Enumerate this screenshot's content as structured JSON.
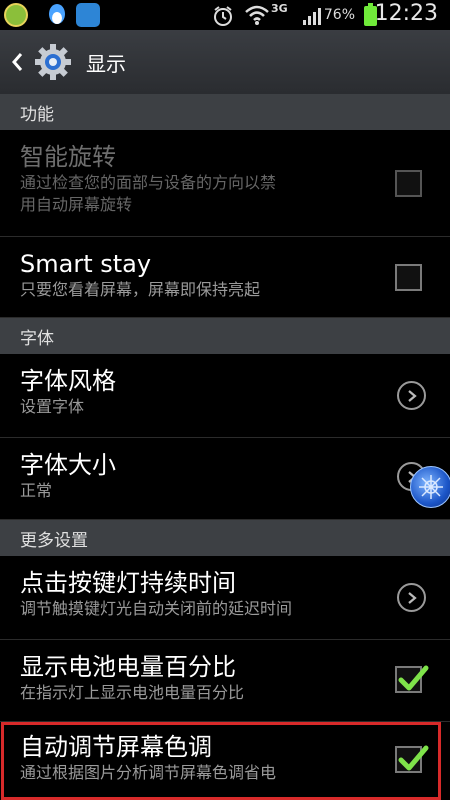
{
  "status_bar": {
    "network": "3G",
    "battery": "76%",
    "time": "12:23",
    "icons": [
      "app-icon",
      "qq-icon",
      "app-icon",
      "alarm-icon",
      "wifi-icon",
      "signal-icon",
      "battery-icon"
    ]
  },
  "header": {
    "title": "显示"
  },
  "sections": {
    "function": "功能",
    "font": "字体",
    "more": "更多设置"
  },
  "rows": {
    "smart_rotation": {
      "title": "智能旋转",
      "subtitle1": "通过检查您的面部与设备的方向以禁",
      "subtitle2": "用自动屏幕旋转"
    },
    "smart_stay": {
      "title": "Smart stay",
      "subtitle": "只要您看着屏幕，屏幕即保持亮起"
    },
    "font_style": {
      "title": "字体风格",
      "subtitle": "设置字体"
    },
    "font_size": {
      "title": "字体大小",
      "subtitle": "正常"
    },
    "key_light": {
      "title": "点击按键灯持续时间",
      "subtitle": "调节触摸键灯光自动关闭前的延迟时间"
    },
    "battery_pct": {
      "title": "显示电池电量百分比",
      "subtitle": "在指示灯上显示电池电量百分比"
    },
    "auto_tone": {
      "title": "自动调节屏幕色调",
      "subtitle": "通过根据图片分析调节屏幕色调省电"
    }
  },
  "accent_color": "#7fe34a"
}
